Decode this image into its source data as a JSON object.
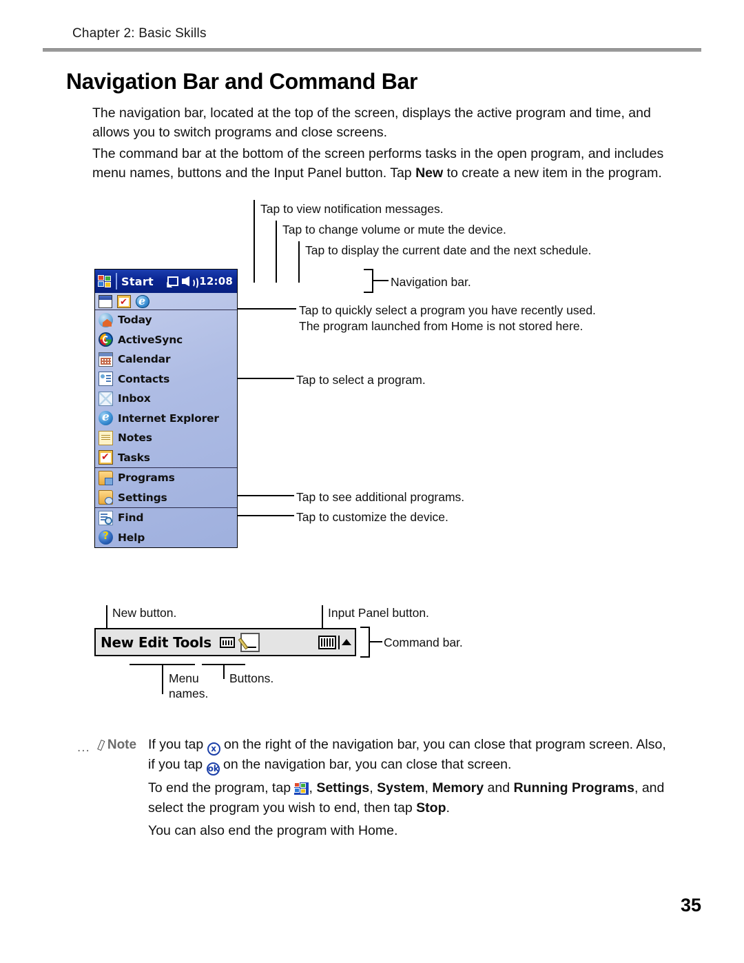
{
  "header": {
    "chapter": "Chapter 2: Basic Skills"
  },
  "title": "Navigation Bar and Command Bar",
  "paragraphs": {
    "p1": "The navigation bar, located at the top of the screen, displays the active program and time, and allows you to switch programs and close screens.",
    "p2_a": "The command bar at the bottom of the screen performs tasks in the open program, and includes menu names, buttons and the Input Panel button. Tap ",
    "p2_bold": "New",
    "p2_b": " to create a new item in the program."
  },
  "callouts": {
    "notification": "Tap to view notification messages.",
    "volume": "Tap to change volume or mute the device.",
    "date": "Tap to display the current date and the next schedule.",
    "navigation_bar": "Navigation bar.",
    "recent_line1": "Tap to quickly select a program you have recently used.",
    "recent_line2": "The program launched from Home is not stored here.",
    "select_program": "Tap to select a program.",
    "additional_programs": "Tap to see additional programs.",
    "customize": "Tap to customize the device.",
    "new_button": "New button.",
    "input_panel_button": "Input Panel button.",
    "command_bar": "Command bar.",
    "menu_names_line1": "Menu",
    "menu_names_line2": "names.",
    "buttons": "Buttons."
  },
  "pda": {
    "nav_bar": {
      "start_label": "Start",
      "time": "12:08",
      "windows_logo_icon": "windows-flag-icon",
      "notification_icon": "notification-screen-icon",
      "volume_icon": "speaker-icon"
    },
    "recent_programs": [
      {
        "icon": "window-icon",
        "name": "recent-program-1"
      },
      {
        "icon": "tasks-clipboard-icon",
        "name": "recent-program-2"
      },
      {
        "icon": "internet-explorer-icon",
        "name": "recent-program-3"
      }
    ],
    "menu_groups": [
      {
        "items": [
          {
            "label": "Today",
            "icon": "today-house-icon"
          },
          {
            "label": "ActiveSync",
            "icon": "activesync-icon"
          },
          {
            "label": "Calendar",
            "icon": "calendar-icon"
          },
          {
            "label": "Contacts",
            "icon": "contacts-card-icon"
          },
          {
            "label": "Inbox",
            "icon": "inbox-envelope-icon"
          },
          {
            "label": "Internet Explorer",
            "icon": "internet-explorer-icon"
          },
          {
            "label": "Notes",
            "icon": "notes-pad-icon"
          },
          {
            "label": "Tasks",
            "icon": "tasks-clipboard-icon"
          }
        ]
      },
      {
        "items": [
          {
            "label": "Programs",
            "icon": "programs-folder-icon"
          },
          {
            "label": "Settings",
            "icon": "settings-folder-icon"
          }
        ]
      },
      {
        "items": [
          {
            "label": "Find",
            "icon": "find-magnifier-icon"
          },
          {
            "label": "Help",
            "icon": "help-question-icon"
          }
        ]
      }
    ]
  },
  "command_bar": {
    "menus": [
      "New",
      "Edit",
      "Tools"
    ],
    "buttons": [
      {
        "name": "record-button",
        "icon": "recorder-icon"
      },
      {
        "name": "draw-button",
        "icon": "pencil-icon"
      }
    ],
    "input_panel": {
      "name": "input-panel-button",
      "icon": "keyboard-icon"
    },
    "input_panel_arrow": {
      "name": "input-panel-arrow",
      "icon": "triangle-up-icon"
    }
  },
  "note": {
    "dots": "...",
    "label": "Note",
    "line1_a": "If you tap ",
    "line1_icon": "x",
    "line1_b": " on the right of the navigation bar, you can close that program screen. Also,",
    "line2_a": "if you tap ",
    "line2_icon": "ok",
    "line2_b": " on the navigation bar, you can close that screen.",
    "line3_a": "To end the program, tap ",
    "line3_b": ", ",
    "line3_bold1": "Settings",
    "line3_sep1": ", ",
    "line3_bold2": "System",
    "line3_sep2": ", ",
    "line3_bold3": "Memory",
    "line3_sep3": " and ",
    "line3_bold4": "Running Programs",
    "line3_c": ", and",
    "line4_a": "select the program you wish to end, then tap ",
    "line4_bold": "Stop",
    "line4_b": ".",
    "line5": "You can also end the program with Home."
  },
  "page_number": "35",
  "colors": {
    "nav_bar_blue": "#0a2491",
    "menu_gradient_top": "#c3cdec",
    "command_bar_gray": "#e4e4e4",
    "note_gray": "#6b6b6b",
    "icon_blue": "#1b3fa8"
  }
}
